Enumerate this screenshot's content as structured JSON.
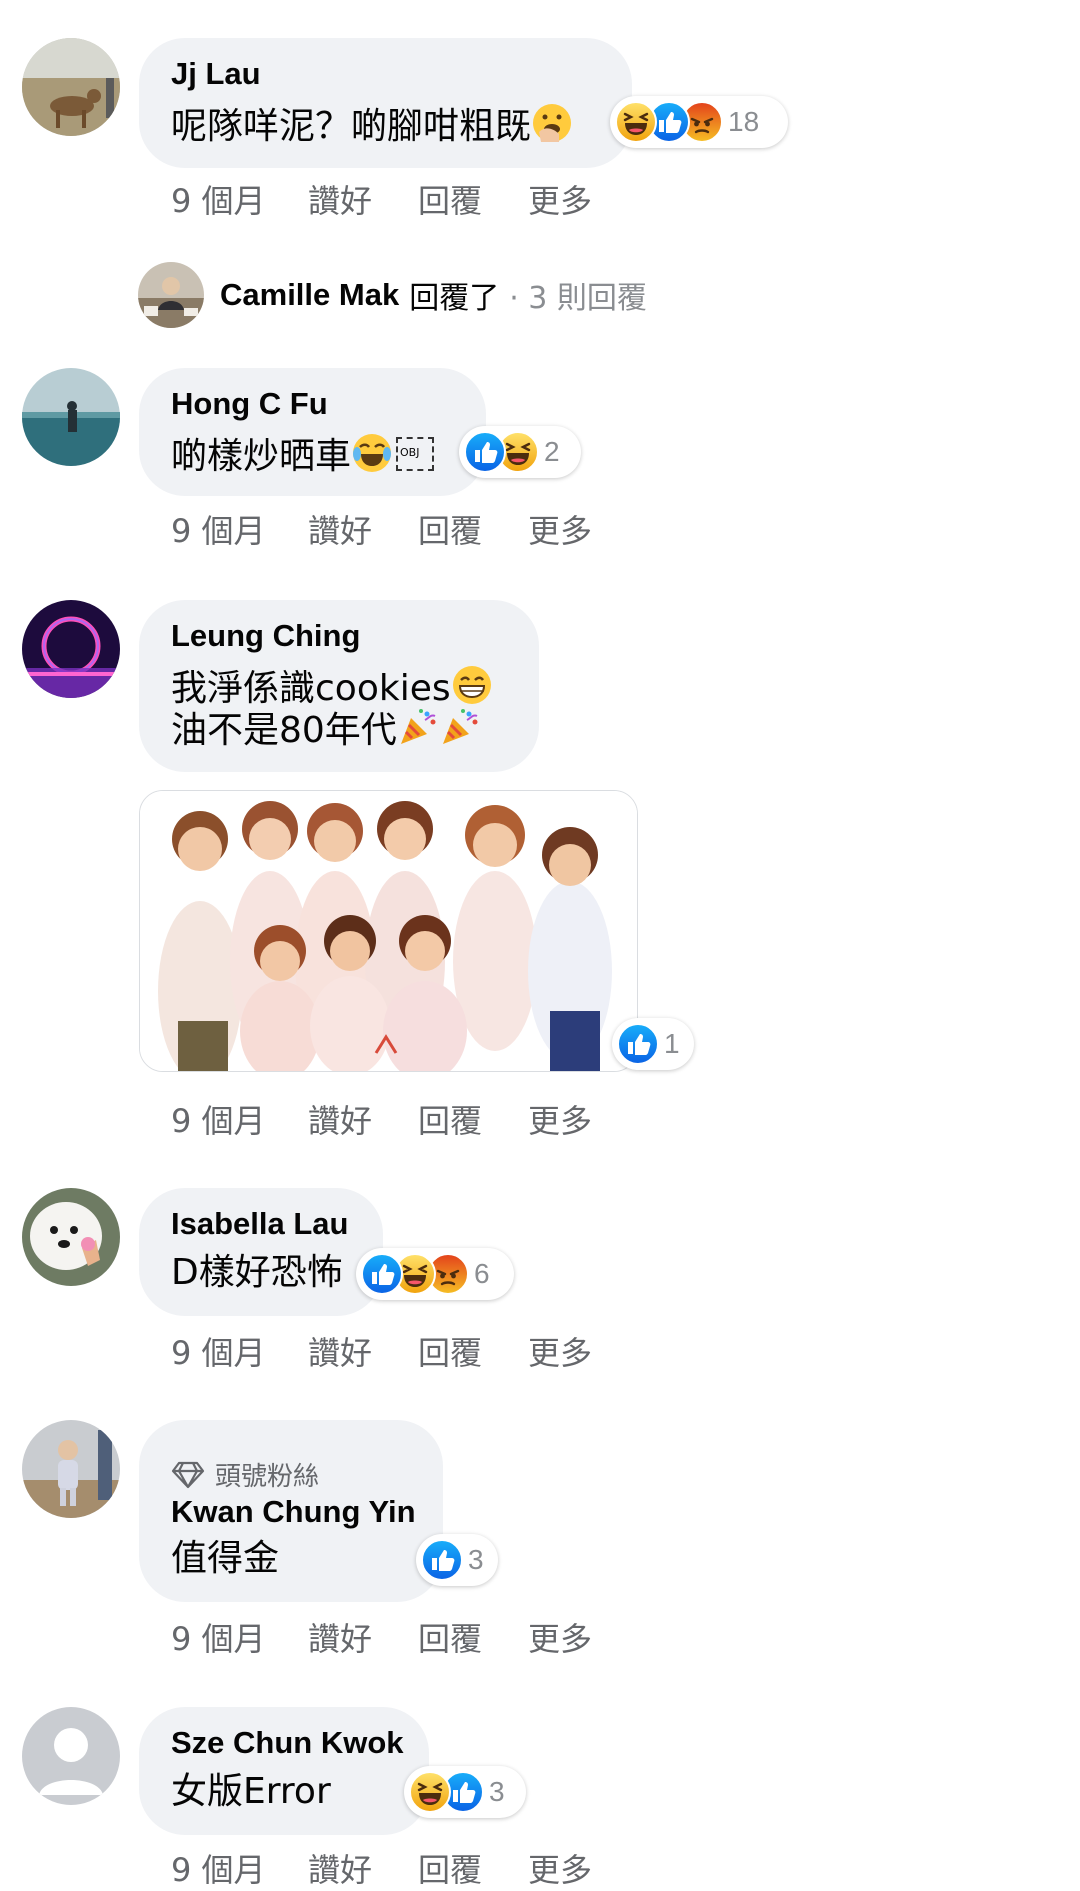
{
  "comments": [
    {
      "author": "Jj Lau",
      "text": "呢隊咩泥？啲腳咁粗既",
      "reactions": [
        "haha",
        "like",
        "angry"
      ],
      "reaction_count": "18",
      "time": "9 個月",
      "like_label": "讚好",
      "reply_label": "回覆",
      "more_label": "更多"
    },
    {
      "author": "Hong C Fu",
      "text": "啲樣炒晒車",
      "obj_placeholder": "OBJ",
      "reactions": [
        "like",
        "haha"
      ],
      "reaction_count": "2",
      "time": "9 個月",
      "like_label": "讚好",
      "reply_label": "回覆",
      "more_label": "更多"
    },
    {
      "author": "Leung Ching",
      "text_line1": "我淨係識cookies",
      "text_line2": "油不是80年代",
      "reactions": [
        "like"
      ],
      "reaction_count": "1",
      "time": "9 個月",
      "like_label": "讚好",
      "reply_label": "回覆",
      "more_label": "更多"
    },
    {
      "author": "Isabella Lau",
      "text": "D樣好恐怖",
      "reactions": [
        "like",
        "haha",
        "angry"
      ],
      "reaction_count": "6",
      "time": "9 個月",
      "like_label": "讚好",
      "reply_label": "回覆",
      "more_label": "更多"
    },
    {
      "author": "Kwan Chung Yin",
      "badge": "頭號粉絲",
      "text": "值得金",
      "reactions": [
        "like"
      ],
      "reaction_count": "3",
      "time": "9 個月",
      "like_label": "讚好",
      "reply_label": "回覆",
      "more_label": "更多"
    },
    {
      "author": "Sze Chun Kwok",
      "text": "女版Error",
      "reactions": [
        "haha",
        "like"
      ],
      "reaction_count": "3",
      "time": "9 個月",
      "like_label": "讚好",
      "reply_label": "回覆",
      "more_label": "更多"
    }
  ],
  "reply_summary": {
    "name": "Camille Mak",
    "replied": "回覆了",
    "count": "· 3 則回覆"
  },
  "colors": {
    "bubble": "#f0f2f5",
    "like_blue": "#1877f2",
    "haha_yellow": "#f7b928",
    "angry_red": "#e9710f",
    "meta_grey": "#65676b"
  }
}
